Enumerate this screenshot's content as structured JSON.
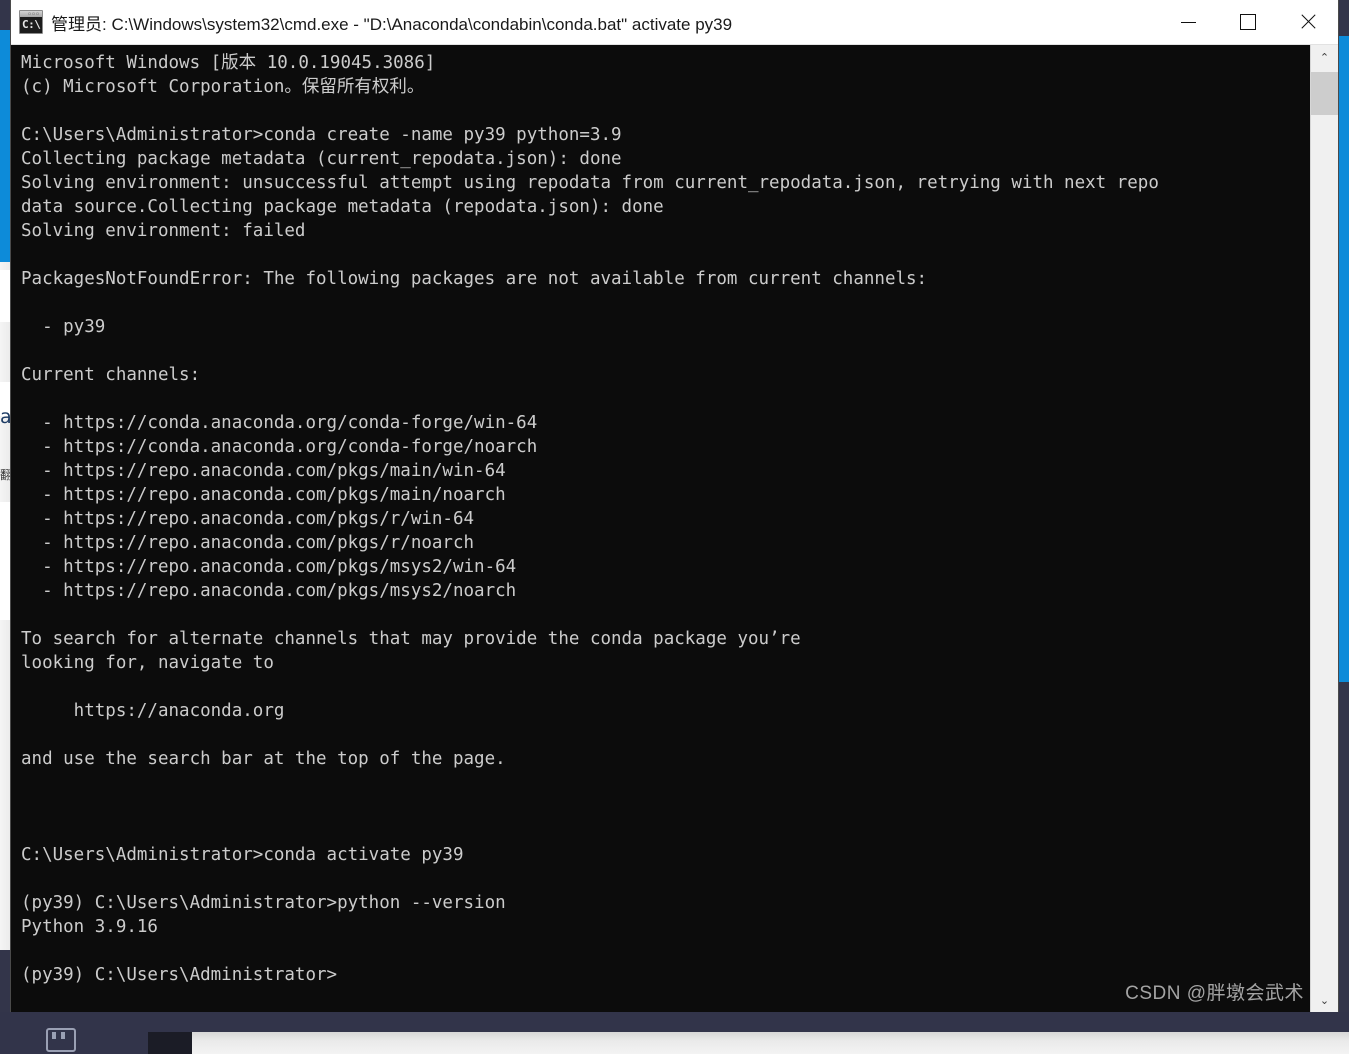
{
  "window": {
    "title": "管理员: C:\\Windows\\system32\\cmd.exe - \"D:\\Anaconda\\condabin\\conda.bat\"  activate py39",
    "icon_prompt": "C:\\",
    "icon_dots": "▫▫▫",
    "buttons": {
      "minimize": "Minimize",
      "maximize": "Maximize",
      "close": "Close"
    }
  },
  "scrollbar": {
    "up_arrow": "⌃",
    "down_arrow": "⌄"
  },
  "console": {
    "lines": [
      "Microsoft Windows [版本 10.0.19045.3086]",
      "(c) Microsoft Corporation。保留所有权利。",
      "",
      "C:\\Users\\Administrator>conda create -name py39 python=3.9",
      "Collecting package metadata (current_repodata.json): done",
      "Solving environment: unsuccessful attempt using repodata from current_repodata.json, retrying with next repo",
      "data source.Collecting package metadata (repodata.json): done",
      "Solving environment: failed",
      "",
      "PackagesNotFoundError: The following packages are not available from current channels:",
      "",
      "  - py39",
      "",
      "Current channels:",
      "",
      "  - https://conda.anaconda.org/conda-forge/win-64",
      "  - https://conda.anaconda.org/conda-forge/noarch",
      "  - https://repo.anaconda.com/pkgs/main/win-64",
      "  - https://repo.anaconda.com/pkgs/main/noarch",
      "  - https://repo.anaconda.com/pkgs/r/win-64",
      "  - https://repo.anaconda.com/pkgs/r/noarch",
      "  - https://repo.anaconda.com/pkgs/msys2/win-64",
      "  - https://repo.anaconda.com/pkgs/msys2/noarch",
      "",
      "To search for alternate channels that may provide the conda package you’re",
      "looking for, navigate to",
      "",
      "     https://anaconda.org",
      "",
      "and use the search bar at the top of the page.",
      "",
      "",
      "",
      "C:\\Users\\Administrator>conda activate py39",
      "",
      "(py39) C:\\Users\\Administrator>python --version",
      "Python 3.9.16",
      "",
      "(py39) C:\\Users\\Administrator>"
    ]
  },
  "background": {
    "sliver_glyph_1": "ai",
    "sliver_glyph_2": "翻"
  },
  "watermark": {
    "text": "CSDN @胖墩会武术"
  },
  "colors": {
    "accent_blue": "#0d8bd9",
    "console_bg": "#0c0c0c",
    "console_fg": "#cccccc",
    "titlebar_bg": "#ffffff",
    "desktop_bg": "#33354a"
  }
}
